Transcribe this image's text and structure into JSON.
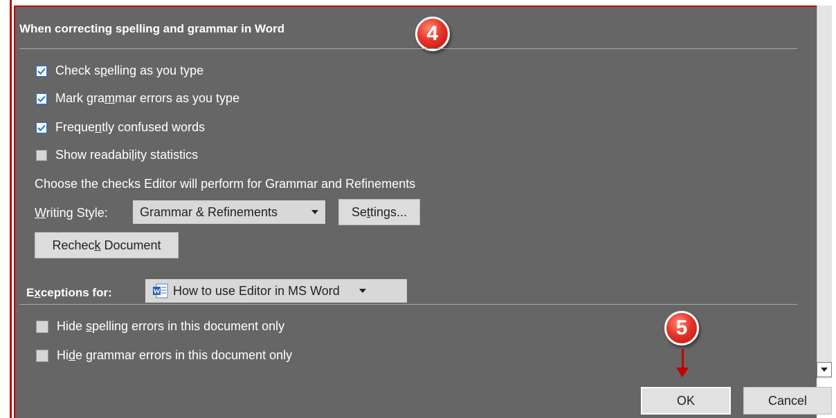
{
  "section_title": "When correcting spelling and grammar in Word",
  "checkboxes": [
    {
      "pre": "Check s",
      "u": "p",
      "post": "elling as you type",
      "checked": true
    },
    {
      "pre": "Mark gra",
      "u": "m",
      "post": "mar errors as you type",
      "checked": true
    },
    {
      "pre": "Freque",
      "u": "n",
      "post": "tly confused words",
      "checked": true
    },
    {
      "pre": "Show readabi",
      "u": "l",
      "post": "ity statistics",
      "checked": false
    }
  ],
  "checks_text": "Choose the checks Editor will perform for Grammar and Refinements",
  "writing_style": {
    "label_u": "W",
    "label_rest": "riting Style:",
    "value": "Grammar & Refinements",
    "settings_pre": "Se",
    "settings_u": "t",
    "settings_post": "tings..."
  },
  "recheck": {
    "pre": "Rechec",
    "u": "k",
    "post": " Document"
  },
  "exceptions": {
    "label_pre": "E",
    "label_u": "x",
    "label_post": "ceptions for:",
    "value": "How to use Editor in MS Word"
  },
  "exception_checkboxes": [
    {
      "pre": "Hide ",
      "u": "s",
      "post": "pelling errors in this document only",
      "checked": false
    },
    {
      "pre": "Hi",
      "u": "d",
      "post": "e grammar errors in this document only",
      "checked": false
    }
  ],
  "buttons": {
    "ok": "OK",
    "cancel": "Cancel"
  },
  "badges": [
    "4",
    "5"
  ],
  "colors": {
    "panel_bg": "#666666",
    "accent_red": "#c00000",
    "checkbox_blue": "#1e6fd0"
  }
}
